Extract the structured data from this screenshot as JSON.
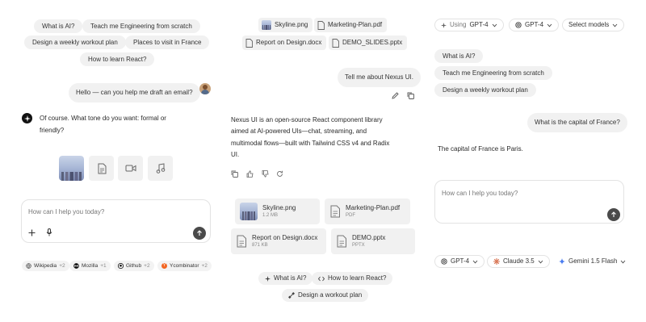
{
  "panel1": {
    "suggestions": [
      "What is AI?",
      "Teach me Engineering from scratch",
      "Design a weekly workout plan",
      "Places to visit in France",
      "How to learn React?"
    ],
    "user_message": "Hello — can you help me draft an email?",
    "assistant_line1": "Of course. What tone do you want: formal or",
    "assistant_line2": "friendly?",
    "input_placeholder": "How can I help you today?",
    "sources": [
      {
        "label": "Wikipedia",
        "count": "+2"
      },
      {
        "label": "Mozilla",
        "count": "+1"
      },
      {
        "label": "Github",
        "count": "+2"
      },
      {
        "label": "Ycombinator",
        "count": "+2"
      }
    ]
  },
  "panel2": {
    "attachments_top": [
      "Skyline.png",
      "Marketing-Plan.pdf",
      "Report on Design.docx",
      "DEMO_SLIDES.pptx"
    ],
    "user_message": "Tell me about Nexus UI.",
    "answer_lines": [
      "Nexus UI is an open-source React component library",
      "aimed at AI-powered UIs—chat, streaming, and",
      "multimodal flows—built with Tailwind CSS v4 and Radix",
      "UI."
    ],
    "files": [
      {
        "name": "Skyline.png",
        "meta": "1.2 MB"
      },
      {
        "name": "Marketing-Plan.pdf",
        "meta": "PDF"
      },
      {
        "name": "Report on Design.docx",
        "meta": "871 KB"
      },
      {
        "name": "DEMO.pptx",
        "meta": "PPTX"
      }
    ],
    "quick_actions": [
      "What is AI?",
      "How to learn React?",
      "Design a workout plan"
    ]
  },
  "panel3": {
    "using_label": "Using",
    "using_model": "GPT-4",
    "model_select": "GPT-4",
    "select_models": "Select models",
    "suggestions": [
      "What is AI?",
      "Teach me Engineering from scratch",
      "Design a weekly workout plan"
    ],
    "user_message": "What is the capital of France?",
    "answer": "The capital of France is Paris.",
    "input_placeholder": "How can I help you today?",
    "models": [
      "GPT-4",
      "Claude 3.5",
      "Gemini 1.5 Flash"
    ]
  },
  "colors": {
    "accent_dark": "#4a4a4a",
    "chip_bg": "#f1f1f1",
    "border": "#e3e3e3",
    "claude": "#d97757",
    "gemini": "#4a7cf0",
    "ycomb": "#f26522"
  }
}
